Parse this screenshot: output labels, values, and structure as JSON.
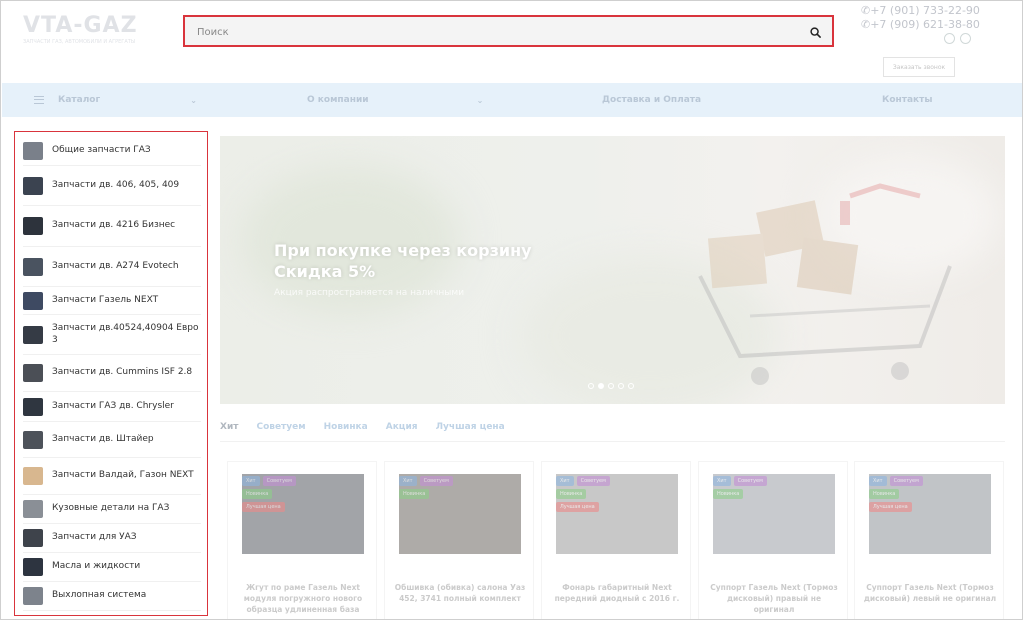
{
  "header": {
    "logo": "VTA-GAZ",
    "logo_tagline": "ЗАПЧАСТИ ГАЗ, АВТОМОБИЛИ И АГРЕГАТЫ",
    "search_placeholder": "Поиск",
    "phones": [
      "+7 (901) 733-22-90",
      "+7 (909) 621-38-80"
    ],
    "callback_label": "Заказать звонок"
  },
  "nav": {
    "items": [
      "Каталог",
      "О компании",
      "Доставка и Оплата",
      "Контакты"
    ]
  },
  "sidebar": {
    "items": [
      {
        "label": "Общие запчасти ГАЗ",
        "h": 30
      },
      {
        "label": "Запчасти дв. 406, 405, 409",
        "h": 40
      },
      {
        "label": "Запчасти дв. 4216 Бизнес",
        "h": 41
      },
      {
        "label": "Запчасти дв. А274 Evotech",
        "h": 40
      },
      {
        "label": "Запчасти Газель NEXT",
        "h": 28
      },
      {
        "label": "Запчасти дв.40524,40904 Евро 3",
        "h": 40
      },
      {
        "label": "Запчасти дв. Cummins ISF 2.8",
        "h": 37
      },
      {
        "label": "Запчасти ГАЗ дв. Chrysler",
        "h": 30
      },
      {
        "label": "Запчасти дв. Штайер",
        "h": 36
      },
      {
        "label": "Запчасти Валдай, Газон NEXT",
        "h": 37
      },
      {
        "label": "Кузовные детали на ГАЗ",
        "h": 29
      },
      {
        "label": "Запчасти для УАЗ",
        "h": 29
      },
      {
        "label": "Масла и жидкости",
        "h": 29
      },
      {
        "label": "Выхлопная система",
        "h": 29
      }
    ]
  },
  "banner": {
    "title": "При покупке через корзину Скидка 5%",
    "subtitle": "Акция распространяется на наличными",
    "slides": 5,
    "active_slide": 1
  },
  "tabs": [
    "Хит",
    "Советуем",
    "Новинка",
    "Акция",
    "Лучшая цена"
  ],
  "products": [
    {
      "name": "Жгут по раме Газель Next модуля погружного нового образца удлиненная база",
      "badges": [
        [
          "Хит",
          "Советуем"
        ],
        [
          "Новинка"
        ],
        [
          "Лучшая цена"
        ]
      ]
    },
    {
      "name": "Обшивка (обивка) салона Уаз 452, 3741 полный комплект",
      "badges": [
        [
          "Хит",
          "Советуем"
        ],
        [
          "Новинка"
        ]
      ]
    },
    {
      "name": "Фонарь габаритный Next передний диодный с 2016 г.",
      "badges": [
        [
          "Хит",
          "Советуем"
        ],
        [
          "Новинка"
        ],
        [
          "Лучшая цена"
        ]
      ]
    },
    {
      "name": "Суппорт Газель Next (Тормоз дисковый) правый не оригинал",
      "badges": [
        [
          "Хит",
          "Советуем"
        ],
        [
          "Новинка"
        ]
      ]
    },
    {
      "name": "Суппорт Газель Next (Тормоз дисковый) левый не оригинал",
      "badges": [
        [
          "Хит",
          "Советуем"
        ],
        [
          "Новинка"
        ],
        [
          "Лучшая цена"
        ]
      ]
    }
  ],
  "colors": {
    "accent_red": "#d9343c",
    "nav_bg": "#e6f1fa",
    "badge_hit": "#8fb6e0",
    "badge_advise": "#c48fd6",
    "badge_new": "#8ed08a",
    "badge_best": "#ee8a8a"
  }
}
